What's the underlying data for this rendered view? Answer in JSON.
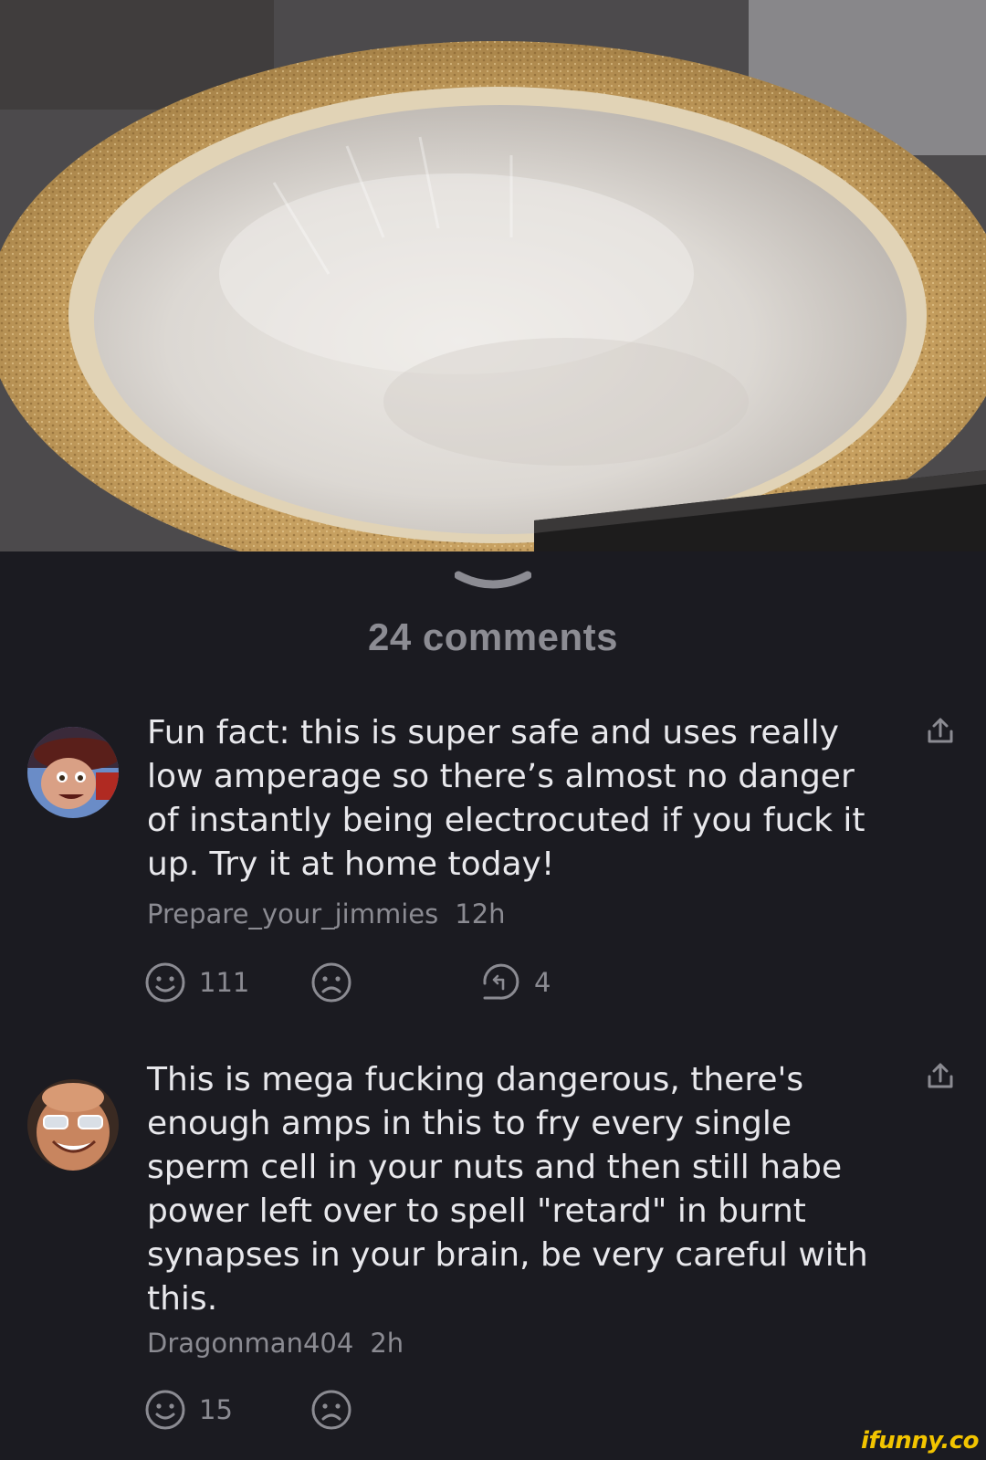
{
  "sheet": {
    "comments_count_label": "24 comments"
  },
  "comments": [
    {
      "text": "Fun fact: this is super safe and uses really low amperage so there’s almost no danger of instantly being electrocuted if you fuck it up. Try it at home today!",
      "username": "Prepare_your_jimmies",
      "time": "12h",
      "smile_count": "111",
      "frown_count": "",
      "reply_count": "4"
    },
    {
      "text": "This is mega fucking dangerous, there's enough amps in this to fry every single sperm cell in your nuts and then still habe power left over to spell \"retard\" in burnt synapses in your brain, be very careful with this.",
      "username": "Dragonman404",
      "time": "2h",
      "smile_count": "15",
      "frown_count": ""
    }
  ],
  "watermark": "ifunny.co",
  "colors": {
    "background": "#1b1b21",
    "text": "#e8e8ec",
    "muted": "#8b8b92",
    "watermark": "#f2c400"
  },
  "icons": [
    "chevron-down-icon",
    "share-icon",
    "smile-icon",
    "frown-icon",
    "reply-icon"
  ]
}
